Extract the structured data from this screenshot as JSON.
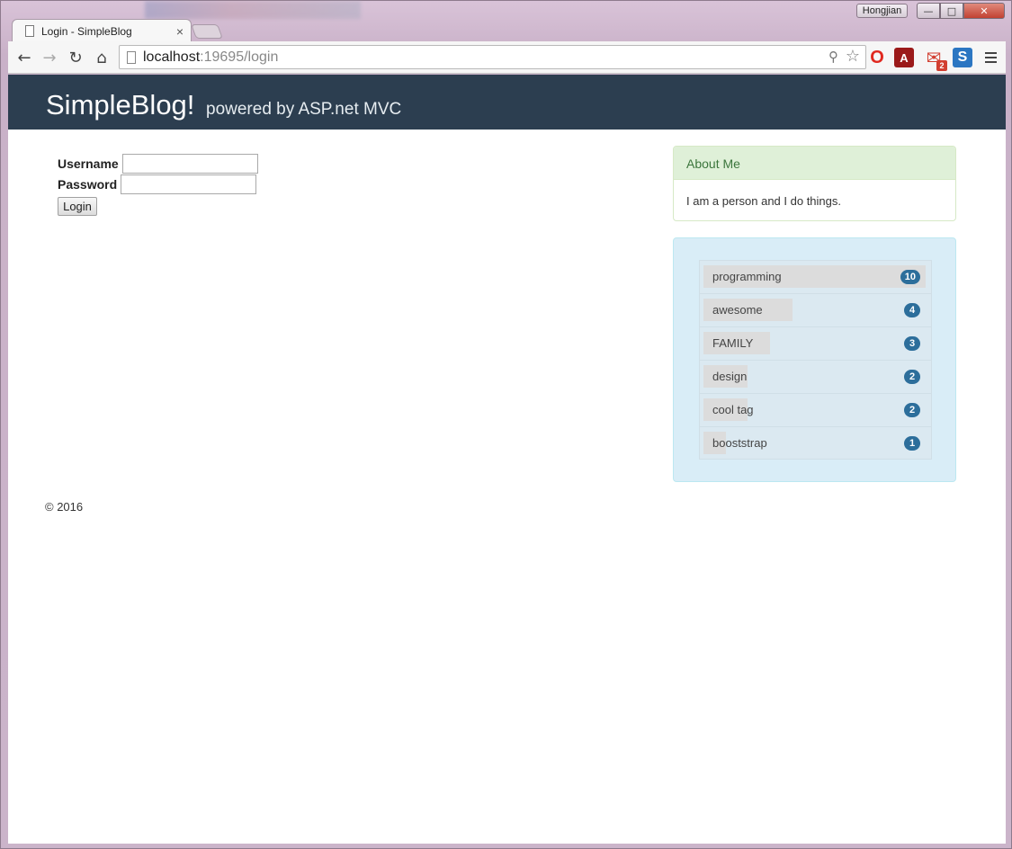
{
  "window": {
    "user_badge": "Hongjian",
    "minimize_icon": "minimize-icon",
    "maximize_icon": "maximize-icon",
    "close_icon": "close-icon"
  },
  "browser": {
    "tab_title": "Login - SimpleBlog",
    "tab_close": "×",
    "url_host": "localhost",
    "url_rest": ":19695/login"
  },
  "site": {
    "brand": "SimpleBlog!",
    "tagline": "powered by ASP.net MVC",
    "footer": "© 2016"
  },
  "login": {
    "username_label": "Username",
    "password_label": "Password",
    "username_value": "",
    "password_value": "",
    "submit_label": "Login"
  },
  "about": {
    "heading": "About Me",
    "body": "I am a person and I do things."
  },
  "tags": [
    {
      "name": "programming",
      "count": "10",
      "weight": 1.0
    },
    {
      "name": "awesome",
      "count": "4",
      "weight": 0.4
    },
    {
      "name": "FAMILY",
      "count": "3",
      "weight": 0.3
    },
    {
      "name": "design",
      "count": "2",
      "weight": 0.2
    },
    {
      "name": "cool tag",
      "count": "2",
      "weight": 0.2
    },
    {
      "name": "booststrap",
      "count": "1",
      "weight": 0.1
    }
  ],
  "extensions": {
    "mail_count": "2"
  },
  "colors": {
    "header_bg": "#2c3e50",
    "about_heading_bg": "#dff0d8",
    "tags_panel_bg": "#d9edf7",
    "badge_bg": "#2c6e9b"
  }
}
